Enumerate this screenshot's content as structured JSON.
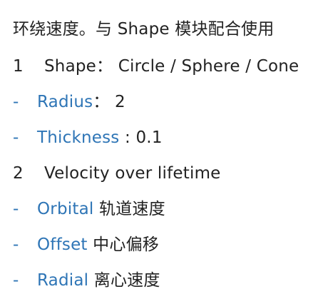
{
  "heading": "环绕速度。与 Shape 模块配合使用",
  "items": [
    {
      "marker": "1",
      "text": "Shape： Circle / Sphere / Cone"
    },
    {
      "marker": "-",
      "key": "Radius",
      "sep": "： ",
      "value": "2"
    },
    {
      "marker": "-",
      "key": "Thickness",
      "sep": " : ",
      "value": "0.1"
    },
    {
      "marker": "2",
      "text": "Velocity over lifetime"
    },
    {
      "marker": "-",
      "key": "Orbital",
      "sep": " ",
      "value": "轨道速度"
    },
    {
      "marker": "-",
      "key": "Offset",
      "sep": " ",
      "value": "中心偏移"
    },
    {
      "marker": "-",
      "key": "Radial",
      "sep": " ",
      "value": "离心速度"
    }
  ],
  "colors": {
    "accent": "#2e75b6",
    "text": "#222222",
    "background": "#ffffff"
  }
}
